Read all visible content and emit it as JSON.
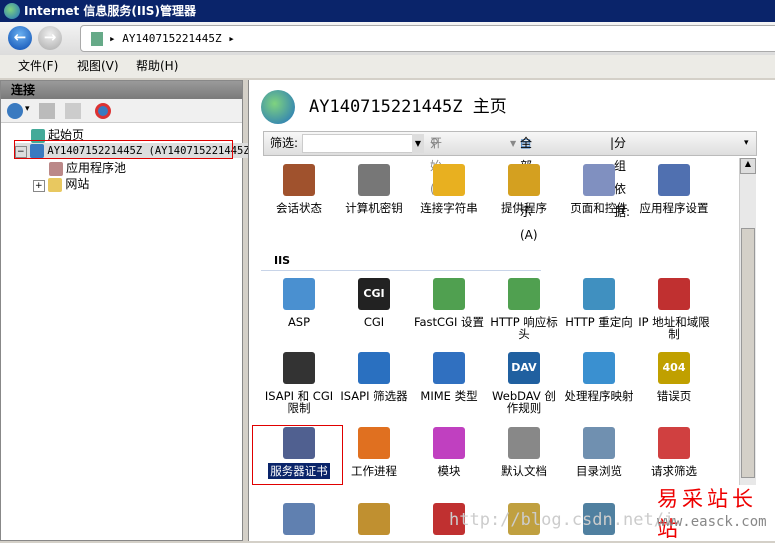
{
  "window": {
    "title": "Internet 信息服务(IIS)管理器"
  },
  "address": {
    "path": "AY140715221445Z"
  },
  "menu": [
    "文件(F)",
    "视图(V)",
    "帮助(H)"
  ],
  "connections": {
    "header": "连接",
    "tree": [
      {
        "label": "起始页"
      },
      {
        "label": "AY140715221445Z (AY140715221445Z"
      },
      {
        "label": "应用程序池"
      },
      {
        "label": "网站"
      }
    ]
  },
  "main": {
    "title": "AY140715221445Z 主页",
    "filter": {
      "label": "筛选:",
      "value": "",
      "go": "开始(G)",
      "show_all": "全部显示(A)",
      "group_by": "分组依据:"
    },
    "section": "IIS",
    "items": [
      {
        "label": "会话状态",
        "icon": "session-state-icon",
        "color": "#a0522d"
      },
      {
        "label": "计算机密钥",
        "icon": "machine-key-icon",
        "color": "#777777"
      },
      {
        "label": "连接字符串",
        "icon": "connection-strings-icon",
        "color": "#e8b020"
      },
      {
        "label": "提供程序",
        "icon": "providers-icon",
        "color": "#d4a020"
      },
      {
        "label": "页面和控件",
        "icon": "pages-controls-icon",
        "color": "#8090c0"
      },
      {
        "label": "应用程序设置",
        "icon": "app-settings-icon",
        "color": "#5070b0"
      },
      {
        "label": "ASP",
        "icon": "asp-icon",
        "color": "#4a90d0"
      },
      {
        "label": "CGI",
        "icon": "cgi-icon",
        "color": "#222222",
        "glyph": "CGI"
      },
      {
        "label": "FastCGI 设置",
        "icon": "fastcgi-icon",
        "color": "#50a050"
      },
      {
        "label": "HTTP 响应标头",
        "icon": "http-headers-icon",
        "color": "#50a050"
      },
      {
        "label": "HTTP 重定向",
        "icon": "http-redirect-icon",
        "color": "#4090c0"
      },
      {
        "label": "IP 地址和域限制",
        "icon": "ip-restrictions-icon",
        "color": "#c03030"
      },
      {
        "label": "ISAPI 和 CGI 限制",
        "icon": "isapi-cgi-icon",
        "color": "#333333"
      },
      {
        "label": "ISAPI 筛选器",
        "icon": "isapi-filters-icon",
        "color": "#2a70c0"
      },
      {
        "label": "MIME 类型",
        "icon": "mime-types-icon",
        "color": "#3070c0"
      },
      {
        "label": "WebDAV 创作规则",
        "icon": "webdav-icon",
        "color": "#2060a0",
        "glyph": "DAV"
      },
      {
        "label": "处理程序映射",
        "icon": "handler-mappings-icon",
        "color": "#3a90d0"
      },
      {
        "label": "错误页",
        "icon": "error-pages-icon",
        "color": "#c0a000",
        "glyph": "404"
      },
      {
        "label": "服务器证书",
        "icon": "server-certificates-icon",
        "color": "#506090",
        "selected": true
      },
      {
        "label": "工作进程",
        "icon": "worker-processes-icon",
        "color": "#e07020"
      },
      {
        "label": "模块",
        "icon": "modules-icon",
        "color": "#c040c0"
      },
      {
        "label": "默认文档",
        "icon": "default-document-icon",
        "color": "#888888"
      },
      {
        "label": "目录浏览",
        "icon": "directory-browsing-icon",
        "color": "#7090b0"
      },
      {
        "label": "请求筛选",
        "icon": "request-filtering-icon",
        "color": "#d04040"
      },
      {
        "label": "",
        "icon": "logging-icon",
        "color": "#6080b0"
      },
      {
        "label": "",
        "icon": "authentication-icon",
        "color": "#c09030"
      },
      {
        "label": "",
        "icon": "failed-request-icon",
        "color": "#c03030"
      },
      {
        "label": "",
        "icon": "authorization-icon",
        "color": "#c0a040"
      },
      {
        "label": "",
        "icon": "compression-icon",
        "color": "#5080a0"
      }
    ]
  },
  "watermark": {
    "brand": "易采站长站",
    "site": "www.easck.com",
    "url": "http://blog.csdn.net/i"
  }
}
